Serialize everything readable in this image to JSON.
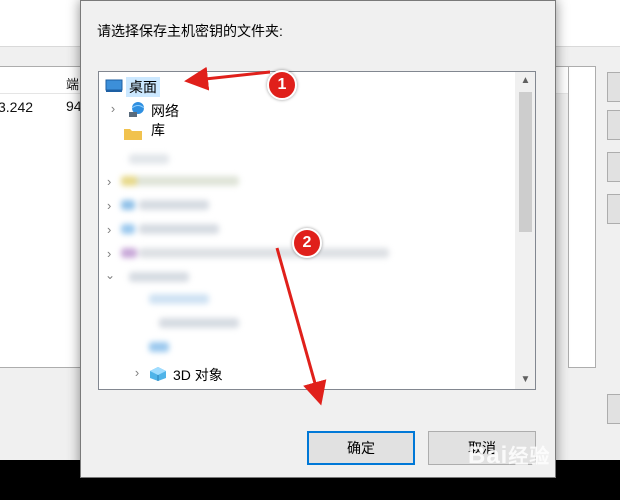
{
  "background_window": {
    "header_col_partial": "端",
    "cell_ip_partial": "3.242",
    "cell_port_partial": "94"
  },
  "dialog": {
    "prompt": "请选择保存主机密钥的文件夹:",
    "tree": {
      "items": [
        {
          "label": "桌面",
          "icon": "desktop-icon",
          "selected": true
        },
        {
          "label": "网络",
          "icon": "network-icon",
          "chevron": "right"
        },
        {
          "label": "库",
          "icon": "folder-icon",
          "chevron": "right",
          "partially_obscured": true
        },
        {
          "label": "3D 对象",
          "icon": "3d-objects-icon",
          "chevron": "right"
        }
      ]
    },
    "ok_label": "确定",
    "cancel_label": "取消"
  },
  "annotations": {
    "badge1": "1",
    "badge2": "2",
    "accent_color": "#e0201b"
  },
  "watermark": {
    "text": "Bai",
    "suffix": "经验"
  }
}
